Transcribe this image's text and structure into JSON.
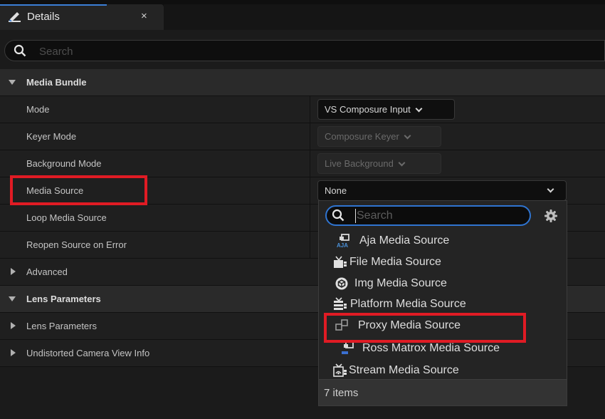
{
  "tab": {
    "title": "Details",
    "close": "×"
  },
  "search": {
    "placeholder": "Search"
  },
  "rows": {
    "media_bundle": "Media Bundle",
    "mode": "Mode",
    "keyer_mode": "Keyer Mode",
    "background_mode": "Background Mode",
    "media_source": "Media Source",
    "loop_media_source": "Loop Media Source",
    "reopen_source": "Reopen Source on Error",
    "advanced": "Advanced",
    "lens_parameters_cat": "Lens Parameters",
    "lens_parameters": "Lens Parameters",
    "undistorted": "Undistorted Camera View Info"
  },
  "values": {
    "mode": "VS Composure Input",
    "keyer_mode": "Composure Keyer",
    "background_mode": "Live Background",
    "media_source": "None"
  },
  "dropdown": {
    "search_placeholder": "Search",
    "items": [
      {
        "label": "Aja Media Source",
        "icon": "aja-icon"
      },
      {
        "label": "File Media Source",
        "icon": "file-media-icon"
      },
      {
        "label": "Img Media Source",
        "icon": "img-media-icon"
      },
      {
        "label": "Platform Media Source",
        "icon": "platform-media-icon"
      },
      {
        "label": "Proxy Media Source",
        "icon": "proxy-media-icon"
      },
      {
        "label": "Ross Matrox Media Source",
        "icon": "ross-matrox-icon"
      },
      {
        "label": "Stream Media Source",
        "icon": "stream-media-icon"
      }
    ],
    "footer": "7 items"
  },
  "colors": {
    "accent": "#2f74d0",
    "highlight": "#e01b24"
  }
}
